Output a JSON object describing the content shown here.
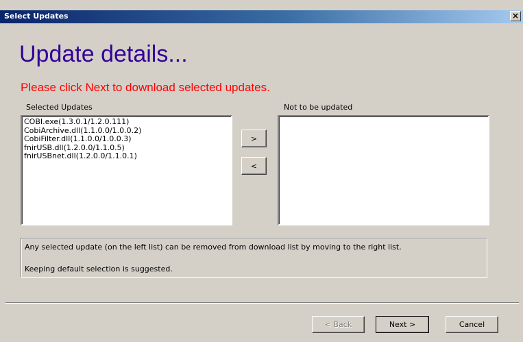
{
  "window": {
    "title": "Select Updates",
    "close_label": "×"
  },
  "main": {
    "heading": "Update details...",
    "instruction": "Please click Next to download selected updates.",
    "instruction_color": "#ff0000",
    "heading_color": "#330099"
  },
  "selected_list": {
    "label": "Selected Updates",
    "items": [
      "COBI.exe(1.3.0.1/1.2.0.111)",
      "CobiArchive.dll(1.1.0.0/1.0.0.2)",
      "CobiFilter.dll(1.1.0.0/1.0.0.3)",
      "fnirUSB.dll(1.2.0.0/1.1.0.5)",
      "fnirUSBnet.dll(1.2.0.0/1.1.0.1)"
    ]
  },
  "not_updated_list": {
    "label": "Not to be updated",
    "items": []
  },
  "move_buttons": {
    "move_right": ">",
    "move_left": "<"
  },
  "info": {
    "line1": "Any selected update (on the left list) can be removed from download list by moving to the right list.",
    "line2": "Keeping default selection is suggested."
  },
  "footer": {
    "back_label": "< Back",
    "next_label": "Next >",
    "cancel_label": "Cancel"
  }
}
